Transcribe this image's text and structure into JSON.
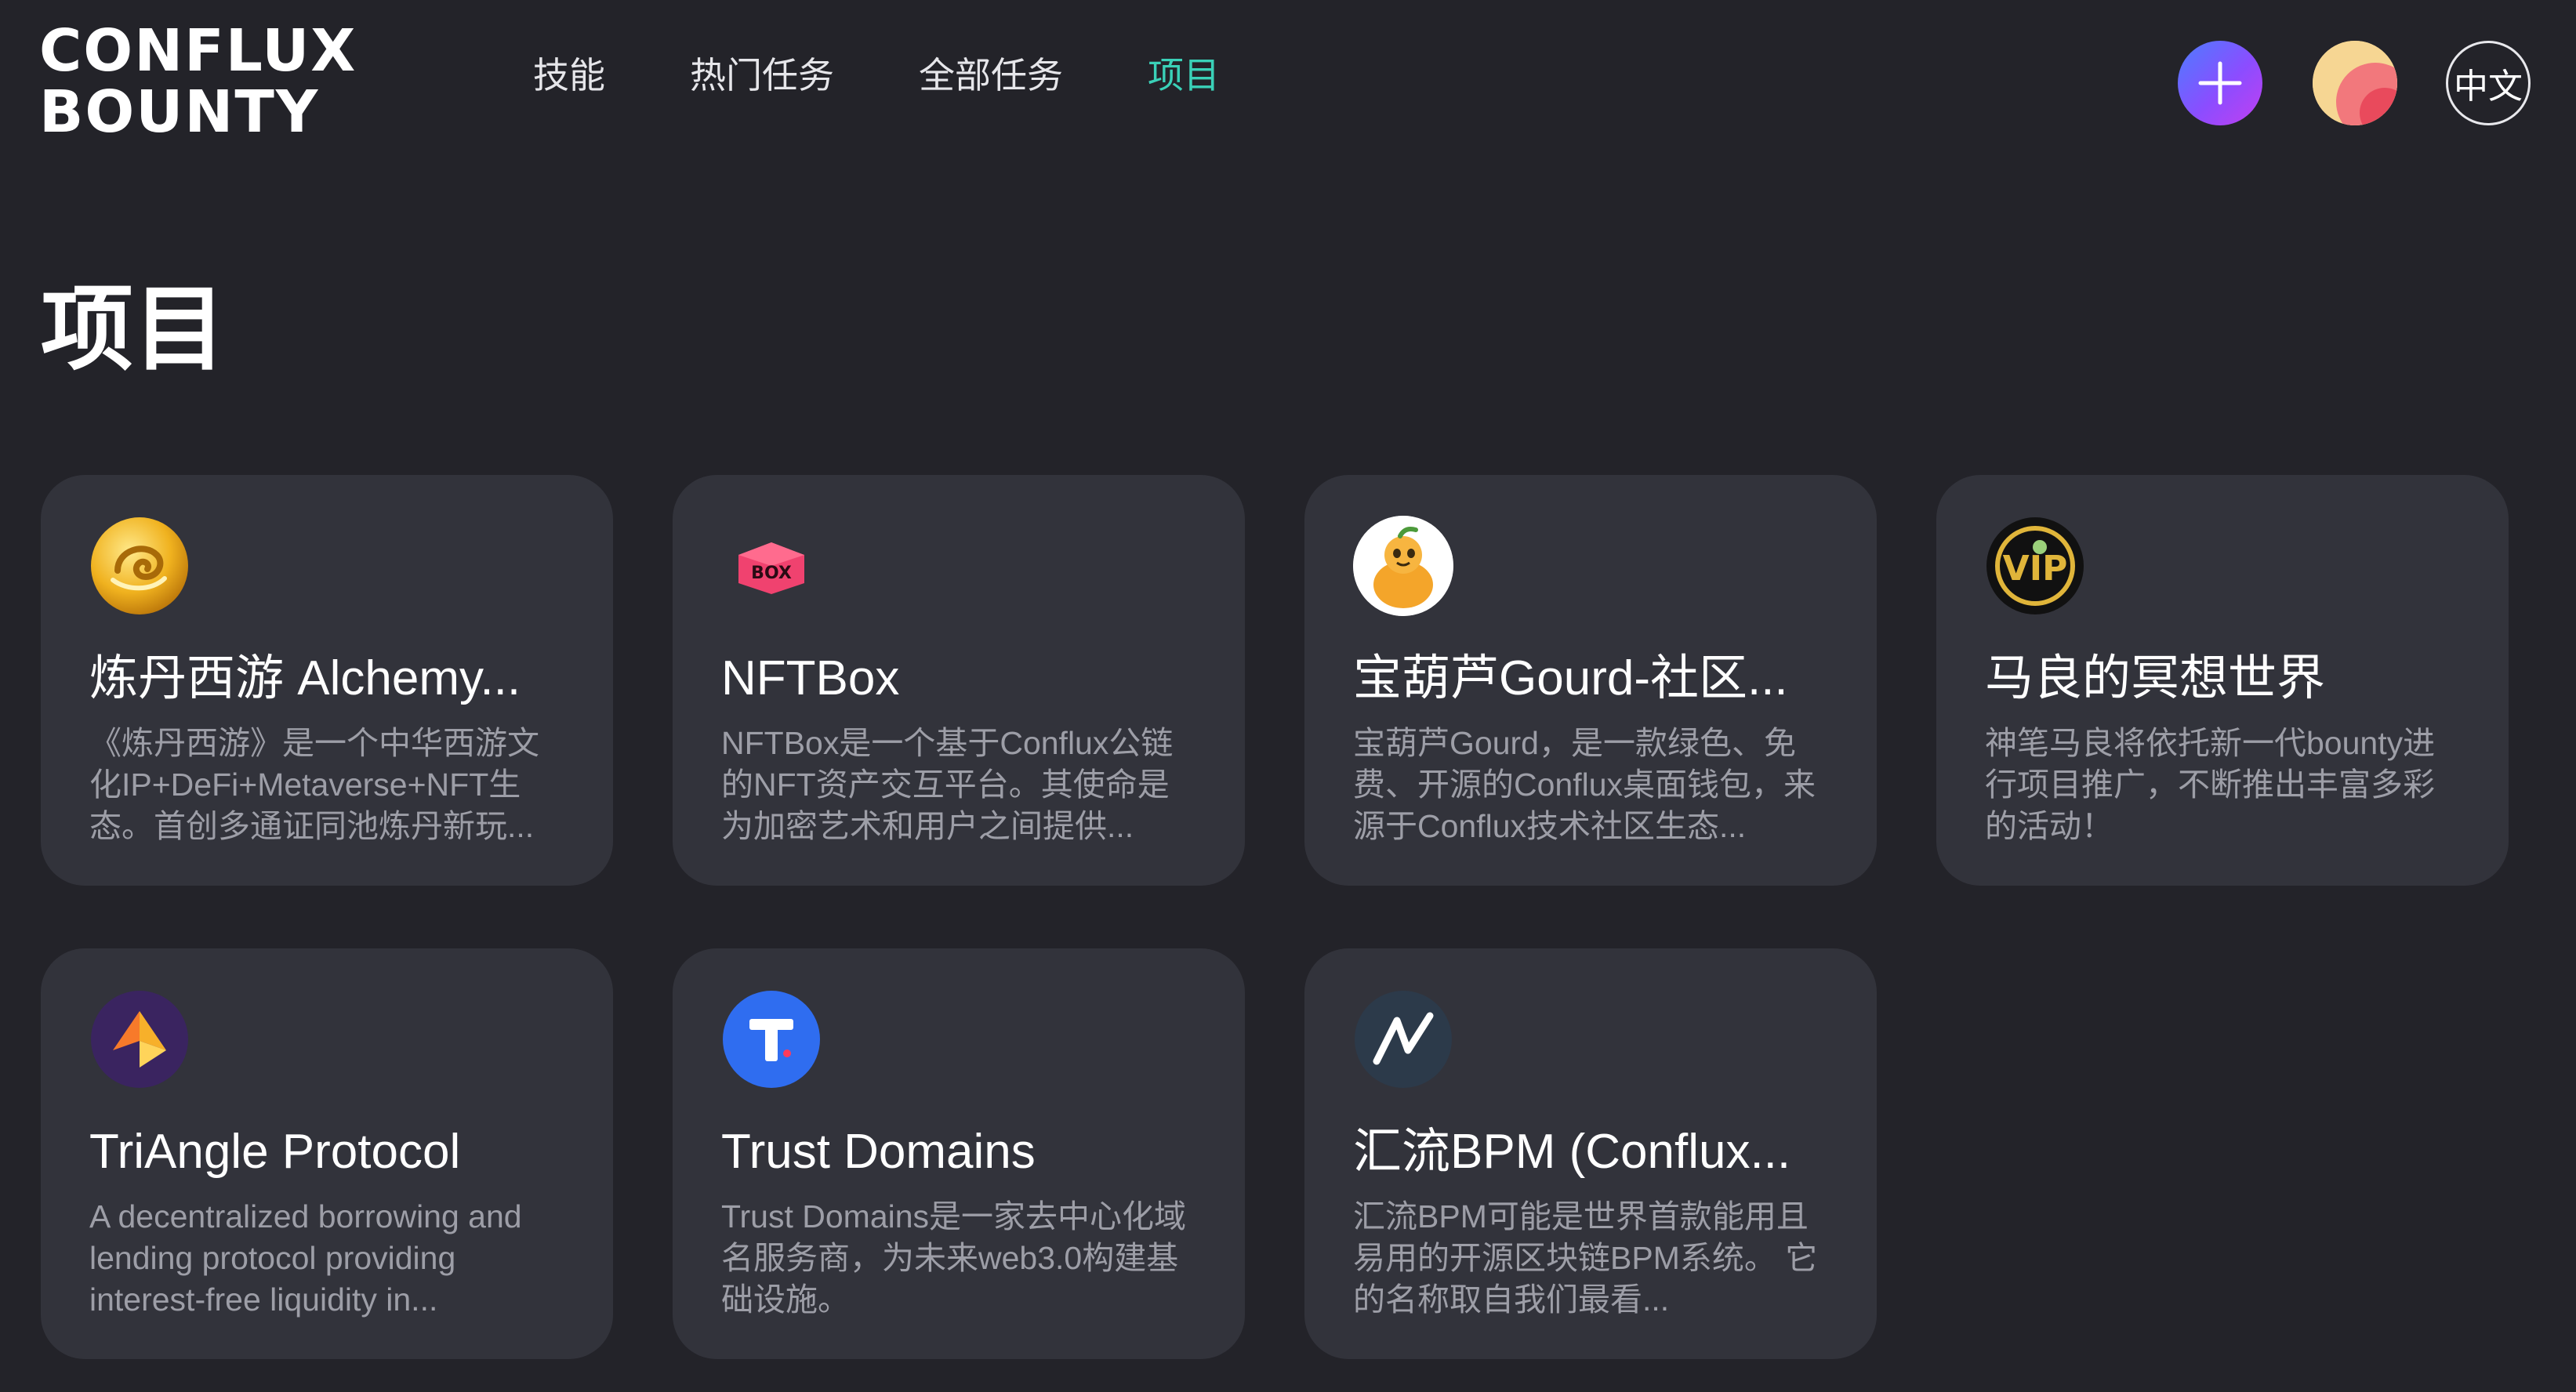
{
  "header": {
    "logo_line1": "CONFLUX",
    "logo_line2": "BOUNTY",
    "nav": [
      {
        "label": "技能"
      },
      {
        "label": "热门任务"
      },
      {
        "label": "全部任务"
      },
      {
        "label": "项目",
        "active": true
      }
    ],
    "add_icon": "plus-icon",
    "avatar_icon": "user-avatar",
    "language_label": "中文"
  },
  "page": {
    "title": "项目"
  },
  "colors": {
    "background": "#232329",
    "card": "#32333b",
    "accent": "#3ad1b8",
    "description": "#9d9ea7"
  },
  "projects": [
    {
      "title": "炼丹西游 Alchemy...",
      "description": "《炼丹西游》是一个中华西游文化IP+DeFi+Metaverse+NFT生态。首创多通证同池炼丹新玩...",
      "icon": "alchemy-logo-icon"
    },
    {
      "title": "NFTBox",
      "description": "NFTBox是一个基于Conflux公链的NFT资产交互平台。其使命是为加密艺术和用户之间提供...",
      "icon": "nftbox-logo-icon"
    },
    {
      "title": "宝葫芦Gourd-社区...",
      "description": "宝葫芦Gourd，是一款绿色、免费、开源的Conflux桌面钱包，来源于Conflux技术社区生态...",
      "icon": "gourd-logo-icon"
    },
    {
      "title": "马良的冥想世界",
      "description": "神笔马良将依托新一代bounty进行项目推广，不断推出丰富多彩的活动！",
      "icon": "vip-logo-icon"
    },
    {
      "title": "TriAngle Protocol",
      "description": "A decentralized borrowing and lending protocol providing interest-free liquidity in...",
      "icon": "triangle-logo-icon"
    },
    {
      "title": "Trust Domains",
      "description": "Trust Domains是一家去中心化域名服务商，为未来web3.0构建基础设施。",
      "icon": "trust-domains-logo-icon"
    },
    {
      "title": "汇流BPM (Conflux...",
      "description": "汇流BPM可能是世界首款能用且易用的开源区块链BPM系统。 它的名称取自我们最看...",
      "icon": "bpm-logo-icon"
    }
  ]
}
